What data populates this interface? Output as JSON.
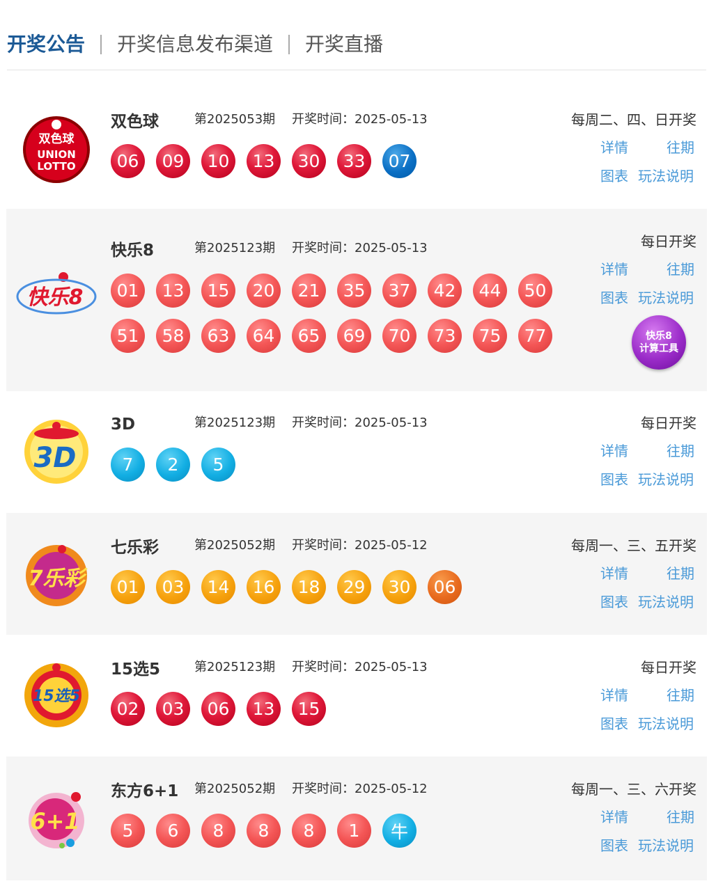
{
  "header": {
    "tabs": [
      {
        "label": "开奖公告"
      },
      {
        "label": "开奖信息发布渠道"
      },
      {
        "label": "开奖直播"
      }
    ]
  },
  "links": {
    "detail": "详情",
    "history": "往期",
    "chart": "图表",
    "rules": "玩法说明"
  },
  "lotteries": [
    {
      "name": "双色球",
      "issue": "第2025053期",
      "draw_time": "开奖时间：2025-05-13",
      "schedule": "每周二、四、日开奖",
      "logo_text": [
        "双色球",
        "UNION",
        "LOTTO"
      ],
      "red_balls": [
        "06",
        "09",
        "10",
        "13",
        "30",
        "33"
      ],
      "blue_balls": [
        "07"
      ]
    },
    {
      "name": "快乐8",
      "issue": "第2025123期",
      "draw_time": "开奖时间：2025-05-13",
      "schedule": "每日开奖",
      "logo_text": [
        "快乐8"
      ],
      "balls": [
        "01",
        "13",
        "15",
        "20",
        "21",
        "35",
        "37",
        "42",
        "44",
        "50",
        "51",
        "58",
        "63",
        "64",
        "65",
        "69",
        "70",
        "73",
        "75",
        "77"
      ],
      "calc_button": [
        "快乐8",
        "计算工具"
      ]
    },
    {
      "name": "3D",
      "issue": "第2025123期",
      "draw_time": "开奖时间：2025-05-13",
      "schedule": "每日开奖",
      "logo_text": [
        "3D"
      ],
      "balls": [
        "7",
        "2",
        "5"
      ]
    },
    {
      "name": "七乐彩",
      "issue": "第2025052期",
      "draw_time": "开奖时间：2025-05-12",
      "schedule": "每周一、三、五开奖",
      "logo_text": [
        "7乐彩"
      ],
      "balls": [
        "01",
        "03",
        "14",
        "16",
        "18",
        "29",
        "30"
      ],
      "special_ball": "06"
    },
    {
      "name": "15选5",
      "issue": "第2025123期",
      "draw_time": "开奖时间：2025-05-13",
      "schedule": "每日开奖",
      "logo_text": [
        "15选5"
      ],
      "balls": [
        "02",
        "03",
        "06",
        "13",
        "15"
      ]
    },
    {
      "name": "东方6+1",
      "issue": "第2025052期",
      "draw_time": "开奖时间：2025-05-12",
      "schedule": "每周一、三、六开奖",
      "logo_text": [
        "6+1"
      ],
      "balls": [
        "5",
        "6",
        "8",
        "8",
        "8",
        "1"
      ],
      "zodiac_ball": "牛"
    }
  ]
}
